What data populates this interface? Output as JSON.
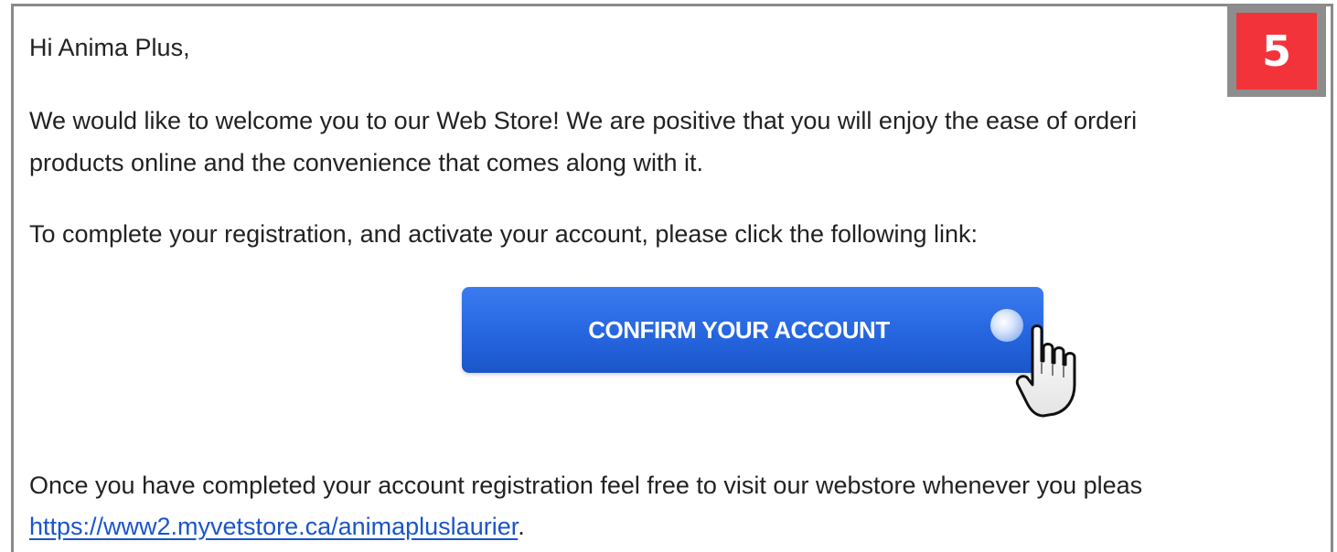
{
  "email": {
    "greeting": "Hi Anima Plus,",
    "welcome_line1": "We would like to welcome you to our Web Store! We are positive that you will enjoy the ease of orderi",
    "welcome_line2": "products online and the convenience that comes along with it.",
    "instruction": "To complete your registration, and activate your account, please click the following link:",
    "confirm_button_label": "CONFIRM YOUR ACCOUNT",
    "closing_line": "Once you have completed your account registration feel free to visit our webstore whenever you pleas",
    "webstore_link": "https://www2.myvetstore.ca/animapluslaurier",
    "link_suffix": "."
  },
  "step_badge": {
    "number": "5",
    "color": "#f2343a"
  },
  "icons": {
    "cursor": "hand-pointer-icon"
  },
  "colors": {
    "button": "#2566e0",
    "link": "#1a55c9"
  }
}
